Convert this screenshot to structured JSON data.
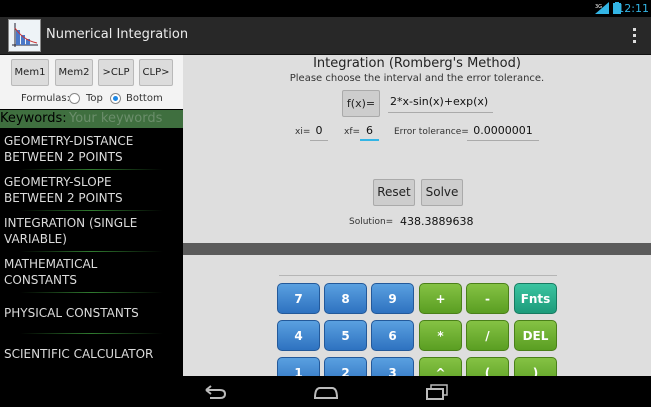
{
  "status_bar": {
    "signal": "3G",
    "time": "12:11"
  },
  "action_bar": {
    "title": "Numerical Integration",
    "icon": "app-icon",
    "overflow_icon": "overflow-menu-icon"
  },
  "left": {
    "mem_buttons": [
      "Mem1",
      "Mem2",
      ">CLP",
      "CLP>"
    ],
    "formulas_label": "Formulas:",
    "radio_top": "Top",
    "radio_bottom": "Bottom",
    "selected_formula": "Bottom",
    "keywords_label": "Keywords:",
    "search_placeholder": "Your keywords",
    "categories": [
      [
        "GEOMETRY-DISTANCE",
        "BETWEEN 2 POINTS"
      ],
      [
        "GEOMETRY-SLOPE",
        "BETWEEN 2 POINTS"
      ],
      [
        "INTEGRATION (SINGLE",
        "VARIABLE)"
      ],
      [
        "MATHEMATICAL",
        "CONSTANTS"
      ],
      [
        "PHYSICAL CONSTANTS",
        ""
      ],
      [
        "SCIENTIFIC CALCULATOR",
        ""
      ]
    ]
  },
  "main": {
    "title": "Integration (Romberg's Method)",
    "subtitle": "Please choose the interval and the error tolerance.",
    "fx_button": "f(x)=",
    "fx_value": "2*x-sin(x)+exp(x)",
    "xi_label": "xi=",
    "xi_value": "0",
    "xf_label": "xf=",
    "xf_value": "6",
    "tol_label": "Error tolerance=",
    "tol_value": "0.0000001",
    "reset": "Reset",
    "solve": "Solve",
    "solution_label": "Solution=",
    "solution_value": "438.3889638"
  },
  "keypad": {
    "rows": [
      [
        "7",
        "8",
        "9",
        "+",
        "-",
        "Fnts"
      ],
      [
        "4",
        "5",
        "6",
        "*",
        "/",
        "DEL"
      ],
      [
        "1",
        "2",
        "3",
        "^",
        "(",
        ")"
      ]
    ],
    "colors": {
      "digit": "#3b82d0",
      "operator": "#6fb030",
      "function": "#22a888"
    }
  },
  "nav_bar": {
    "icons": [
      "back-icon",
      "home-icon",
      "recent-apps-icon"
    ]
  }
}
